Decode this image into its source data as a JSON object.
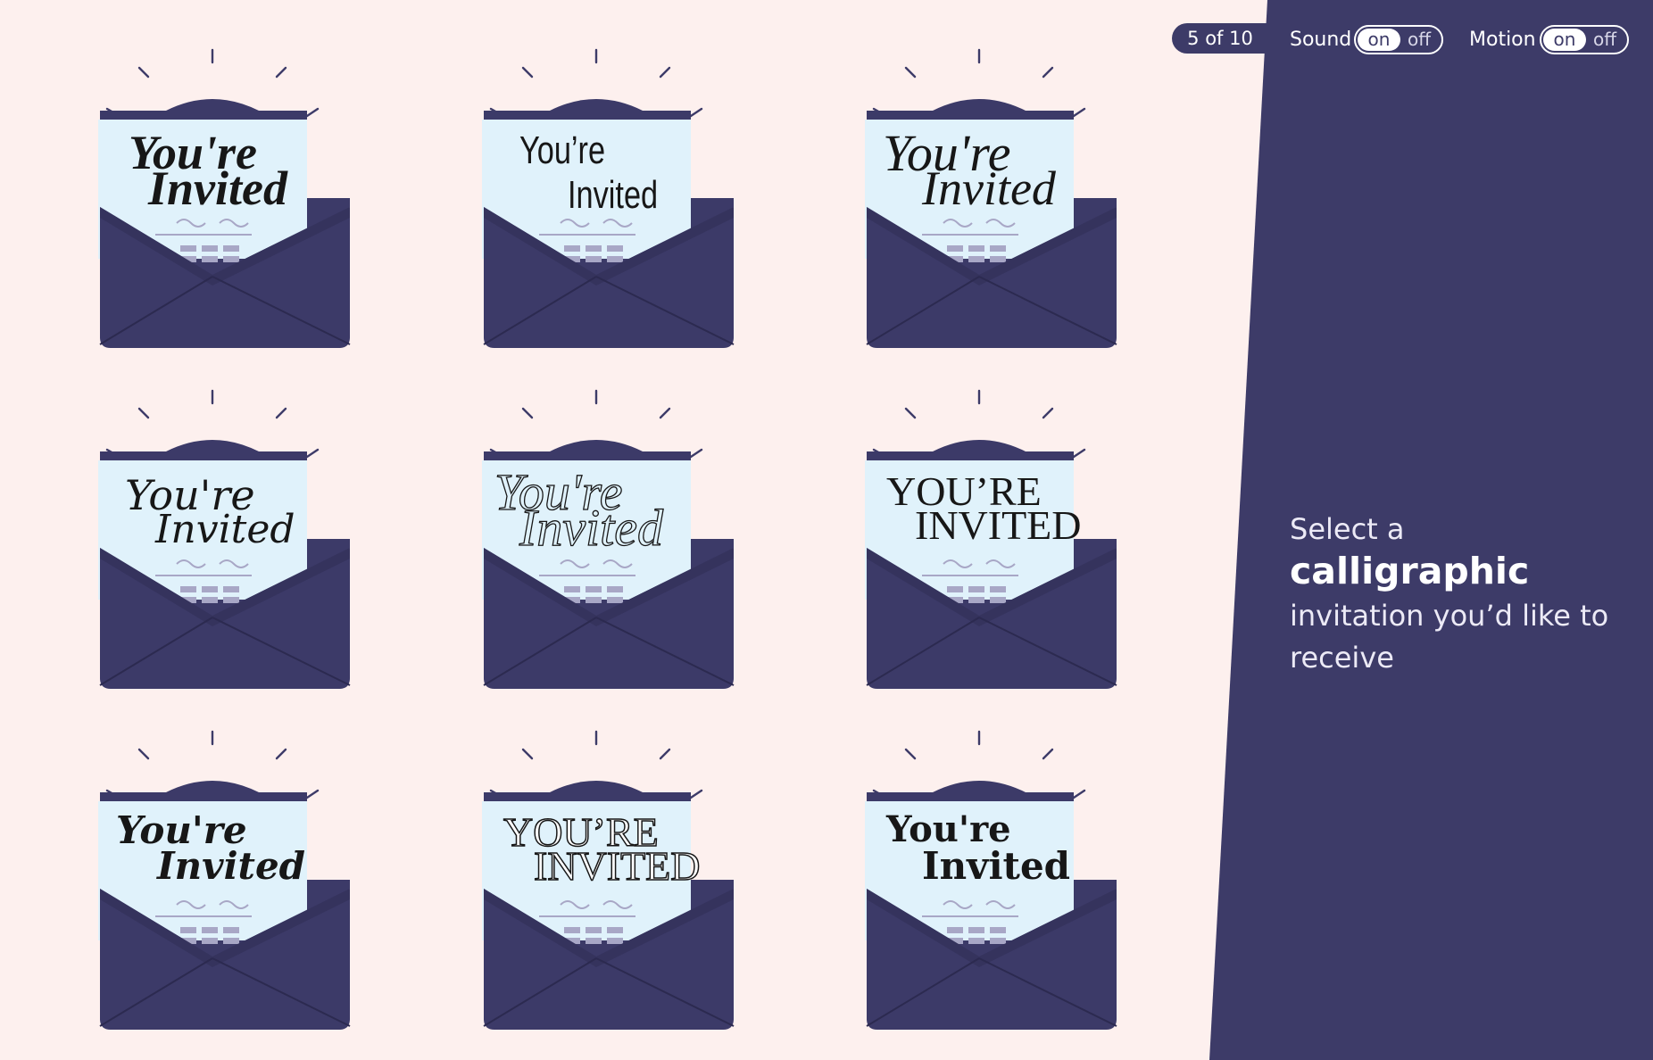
{
  "header": {
    "counter": "5 of 10",
    "sound": {
      "label": "Sound",
      "on": "on",
      "off": "off",
      "value": "on"
    },
    "motion": {
      "label": "Motion",
      "on": "on",
      "off": "off",
      "value": "on"
    }
  },
  "prompt": {
    "prefix": "Select a ",
    "emphasis": "calligraphic",
    "suffix": " invitation you’d like to receive"
  },
  "colors": {
    "background": "#fdf0ee",
    "panel": "#3d3b68",
    "envelope": "#3c3a68",
    "letter": "#e0f2fb"
  },
  "invitations": [
    {
      "line1": "You're",
      "line2": "Invited",
      "style": "bold italic serif"
    },
    {
      "line1": "You’re",
      "line2": "Invited",
      "style": "hand lettered"
    },
    {
      "line1": "You're",
      "line2": "Invited",
      "style": "flourished script"
    },
    {
      "line1": "You're",
      "line2": "Invited",
      "style": "italic script"
    },
    {
      "line1": "You're",
      "line2": "Invited",
      "style": "outlined swash script"
    },
    {
      "line1": "YOU’RE",
      "line2": "INVITED",
      "style": "caps serif"
    },
    {
      "line1": "You're",
      "line2": "Invited",
      "style": "blackletter"
    },
    {
      "line1": "YOU’RE",
      "line2": "INVITED",
      "style": "inline caps serif"
    },
    {
      "line1": "You're",
      "line2": "Invited",
      "style": "uncial"
    }
  ]
}
